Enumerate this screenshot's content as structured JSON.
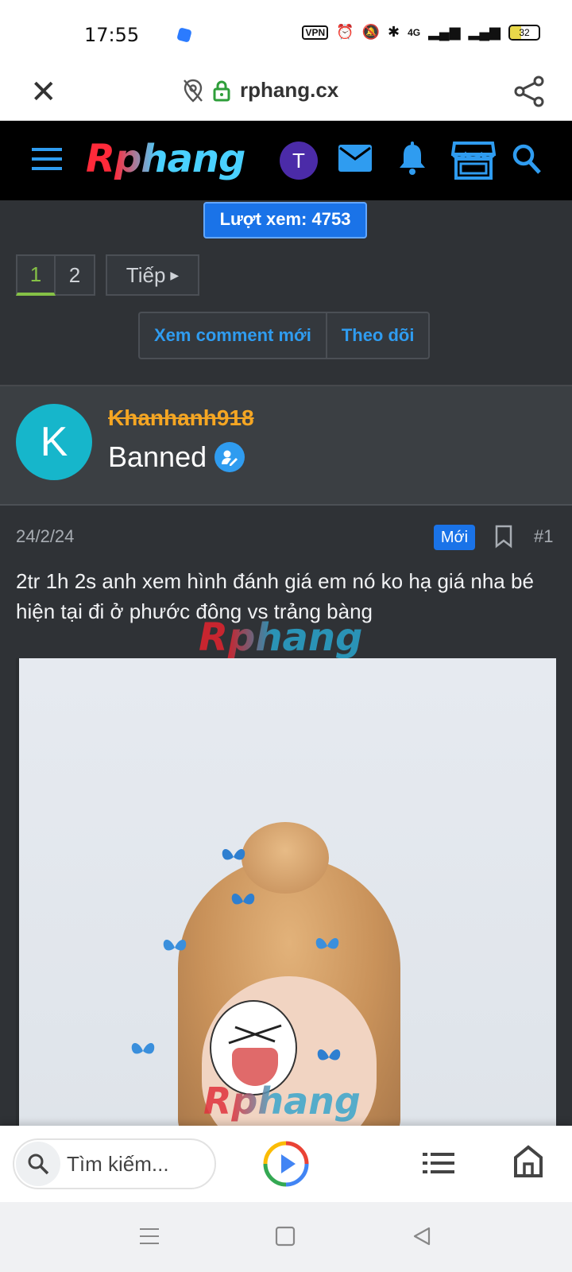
{
  "status_bar": {
    "time": "17:55",
    "vpn": "VPN",
    "net": "4G",
    "battery": "32"
  },
  "browser": {
    "url": "rphang.cx"
  },
  "site_nav": {
    "logo": "Rphang",
    "avatar_letter": "T"
  },
  "thread": {
    "views_label": "Lượt xem: 4753",
    "pages": [
      "1",
      "2"
    ],
    "next_label": "Tiếp",
    "actions": [
      "Xem comment mới",
      "Theo dõi"
    ]
  },
  "user": {
    "avatar_letter": "K",
    "username": "Khanhanh918",
    "role": "Banned"
  },
  "post": {
    "date": "24/2/24",
    "new_badge": "Mới",
    "number": "#1",
    "body": "2tr 1h 2s anh xem hình đánh giá em nó ko hạ giá nha bé hiện tại đi ở phước đông vs trảng bàng",
    "watermark": "Rphang"
  },
  "bottom_bar": {
    "search_placeholder": "Tìm kiếm..."
  },
  "colors": {
    "site_bg": "#2f3236",
    "accent_blue": "#1a73e8",
    "link_blue": "#2f9cf0",
    "banned_orange": "#f5a623",
    "avatar_teal": "#16b6cb",
    "active_page_green": "#85c146"
  }
}
